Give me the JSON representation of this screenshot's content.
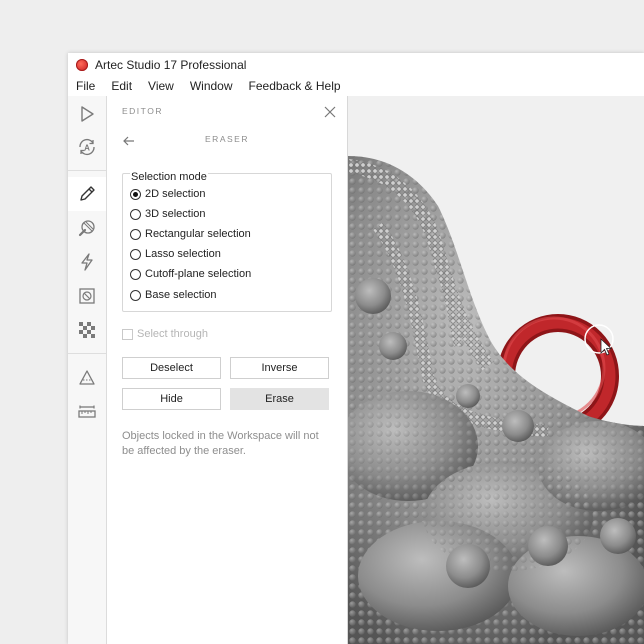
{
  "window": {
    "title": "Artec Studio 17 Professional"
  },
  "menu": [
    "File",
    "Edit",
    "View",
    "Window",
    "Feedback & Help"
  ],
  "toolbar": {
    "tools": [
      "play-icon",
      "autopilot-icon",
      "pencil-icon",
      "tools-icon",
      "lightning-icon",
      "texture-icon",
      "checker-icon",
      "measure-triangle-icon",
      "ruler-icon"
    ],
    "active": "pencil-icon"
  },
  "panel": {
    "header": "EDITOR",
    "subtitle": "ERASER",
    "selection_mode": {
      "label": "Selection mode",
      "options": [
        "2D selection",
        "3D selection",
        "Rectangular selection",
        "Lasso selection",
        "Cutoff-plane selection",
        "Base selection"
      ],
      "selected": "2D selection"
    },
    "select_through": "Select through",
    "buttons": {
      "deselect": "Deselect",
      "inverse": "Inverse",
      "hide": "Hide",
      "erase": "Erase"
    },
    "note": "Objects locked in the Workspace will not be affected by the eraser."
  },
  "colors": {
    "accent": "#c4161c",
    "selection": "#b01d20",
    "mesh": "#8f8f8f"
  }
}
